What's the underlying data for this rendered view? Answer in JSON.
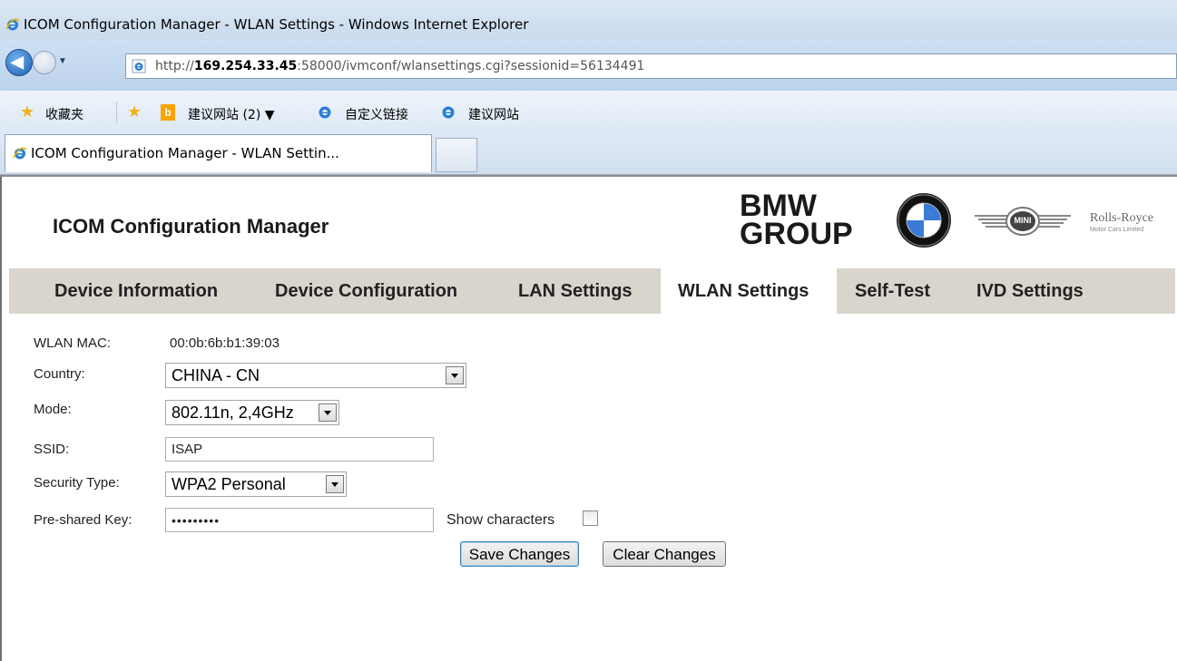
{
  "browser": {
    "window_title": "ICOM Configuration Manager - WLAN Settings - Windows Internet Explorer",
    "address_prefix": "http://",
    "address_host": "169.254.33.45",
    "address_rest": ":58000/ivmconf/wlansettings.cgi?sessionid=56134491",
    "favorites": {
      "favorites_label": "收藏夹",
      "suggested_sites_dropdown": "建议网站 (2) ▼",
      "custom_links": "自定义链接",
      "suggested_sites": "建议网站"
    },
    "tab_title": "ICOM Configuration Manager - WLAN Settin..."
  },
  "header": {
    "app_title": "ICOM Configuration Manager",
    "brand_line1": "BMW",
    "brand_line2": "GROUP",
    "mini_text": "MINI",
    "rr_name": "Rolls-Royce",
    "rr_sub": "Motor Cars Limited"
  },
  "nav": {
    "tabs": [
      {
        "label": "Device Information"
      },
      {
        "label": "Device Configuration"
      },
      {
        "label": "LAN Settings"
      },
      {
        "label": "WLAN Settings",
        "active": true
      },
      {
        "label": "Self-Test"
      },
      {
        "label": "IVD Settings"
      }
    ]
  },
  "form": {
    "wlan_mac_label": "WLAN MAC:",
    "wlan_mac_value": "00:0b:6b:b1:39:03",
    "country_label": "Country:",
    "country_value": "CHINA - CN",
    "mode_label": "Mode:",
    "mode_value": "802.11n, 2,4GHz",
    "ssid_label": "SSID:",
    "ssid_value": "ISAP",
    "security_label": "Security Type:",
    "security_value": "WPA2 Personal",
    "psk_label": "Pre-shared Key:",
    "psk_value": "•••••••••",
    "show_chars_label": "Show characters",
    "show_chars_checked": false,
    "save_label": "Save Changes",
    "clear_label": "Clear Changes"
  },
  "colors": {
    "nav_bg": "#d9d5cd",
    "active_tab_bg": "#ffffff",
    "text": "#222222"
  }
}
